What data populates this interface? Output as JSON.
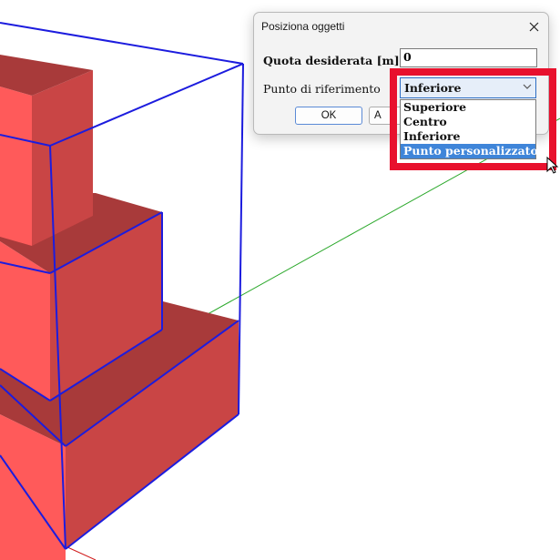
{
  "dialog": {
    "title": "Posiziona oggetti",
    "quota_label": "Quota desiderata [m] =",
    "quota_value": "0",
    "riferimento_label": "Punto di riferimento",
    "selected_value": "Inferiore",
    "options": [
      "Superiore",
      "Centro",
      "Inferiore",
      "Punto personalizzato"
    ],
    "highlighted_option": "Punto personalizzato",
    "ok_label": "OK",
    "cancel_label_visible": "A"
  },
  "icons": {
    "close": "close-icon",
    "dropdown": "chevron-down-icon",
    "cursor": "mouse-cursor-icon"
  },
  "colors": {
    "solid_face_light": "#ff5a5a",
    "solid_face_dark": "#c94545",
    "solid_top": "#a83a3a",
    "selection_edges": "#1c1cde",
    "highlight_frame": "#e8112d",
    "selected_option": "#3f85d9",
    "green_axis": "#2aa82a",
    "red_axis": "#d01b1b"
  }
}
